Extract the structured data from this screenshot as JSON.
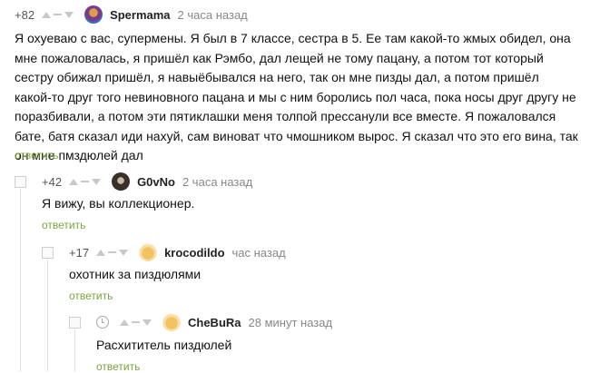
{
  "comments": [
    {
      "rating": "+82",
      "username": "Spermama",
      "time": "2 часа назад",
      "text": "Я охуеваю с вас, супермены. Я был в 7 классе, сестра в 5. Ее там какой-то жмых обидел, она мне пожаловалась, я пришёл как Рэмбо, дал лещей не тому пацану, а потом тот который сестру обижал пришёл, я навыёбывался на него, так он мне пизды дал, а потом пришёл какой-то друг того невиновного пацана и мы с ним боролись пол часа, пока носы друг другу не поразбивали, а потом эти пятиклашки меня толпой прессанули все вместе. Я пожаловался бате, батя сказал иди нахуй, сам виноват что чмошником вырос. Я сказал что это его вина, так он мне пмздюлей дал",
      "reply": "ответить"
    },
    {
      "rating": "+42",
      "username": "G0vNo",
      "time": "2 часа назад",
      "text": "Я вижу, вы коллекционер.",
      "reply": "ответить"
    },
    {
      "rating": "+17",
      "username": "krocodildo",
      "time": "час назад",
      "text": "охотник за пиздюлями",
      "reply": "ответить"
    },
    {
      "rating": "",
      "username": "CheBuRa",
      "time": "28 минут назад",
      "text": "Расхититель пиздюлей",
      "reply": "ответить"
    }
  ],
  "icons": {
    "upvote": "upvote-triangle-icon",
    "downvote": "downvote-triangle-icon",
    "pending": "clock-icon"
  },
  "colors": {
    "reply_link": "#7aa53f",
    "rating": "#555555",
    "time": "#888888"
  }
}
